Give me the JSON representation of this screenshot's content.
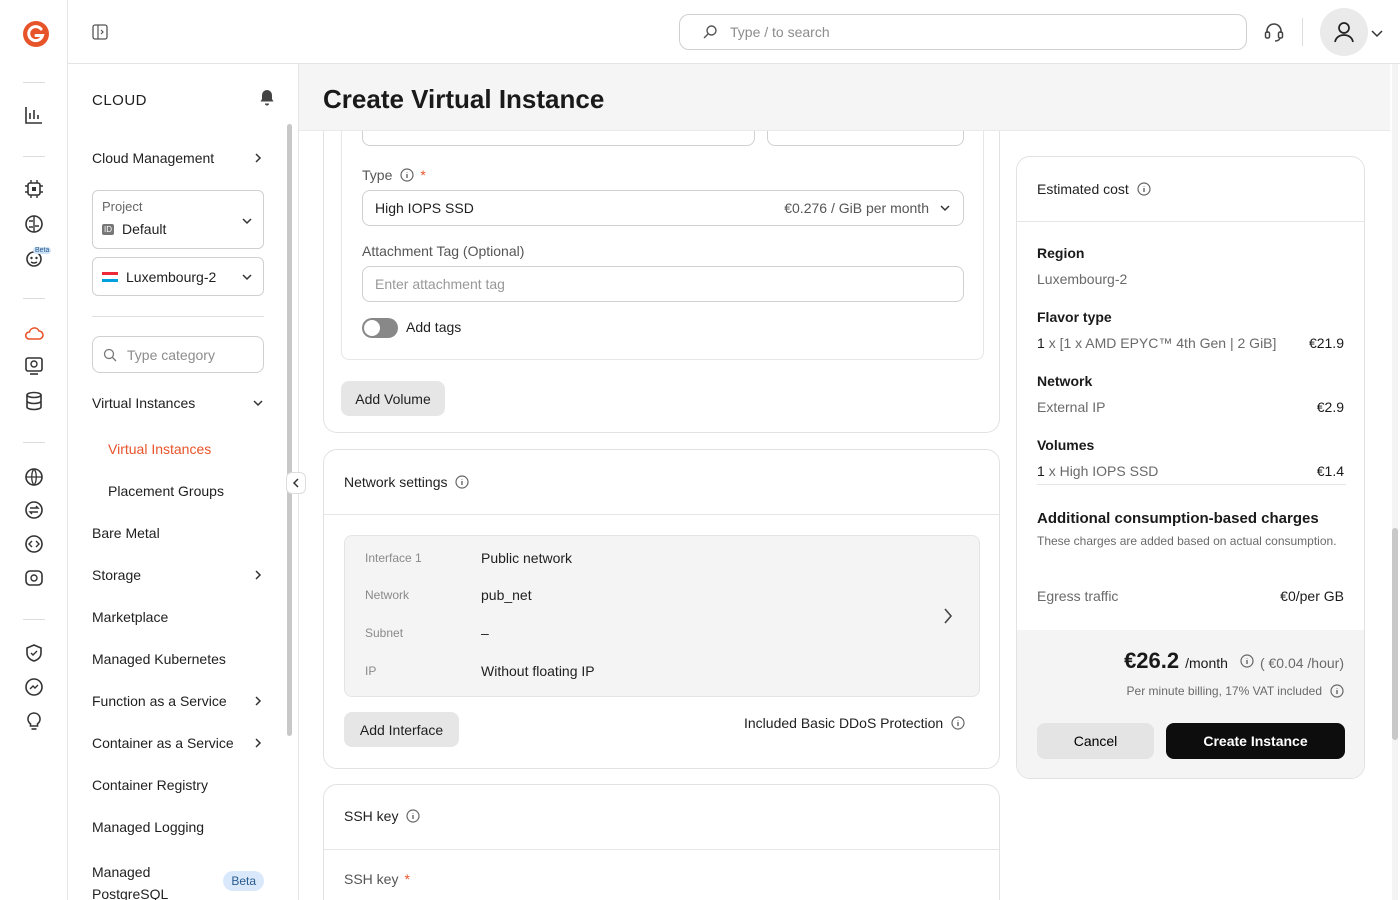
{
  "colors": {
    "accent": "#e8542a",
    "primary_button": "#0d0d0d",
    "beta_badge": "#d9e9fb"
  },
  "rail": {
    "icons": [
      "logo-icon",
      "analytics-icon",
      "chip-icon",
      "brain-icon",
      "robot-beta-icon",
      "cloud-icon",
      "monitor-icon",
      "database-icon",
      "globe-icon",
      "transfer-icon",
      "code-icon",
      "media-icon",
      "shield-icon",
      "handshake-icon",
      "bulb-icon"
    ],
    "beta_label": "Beta"
  },
  "topbar": {
    "search_placeholder": "Type / to search"
  },
  "sidebar": {
    "title": "CLOUD",
    "cloud_management": "Cloud Management",
    "project_label": "Project",
    "project_id_badge": "ID",
    "project_value": "Default",
    "region_value": "Luxembourg-2",
    "category_placeholder": "Type category",
    "items": [
      {
        "label": "Virtual Instances"
      },
      {
        "label": "Virtual Instances"
      },
      {
        "label": "Placement Groups"
      },
      {
        "label": "Bare Metal"
      },
      {
        "label": "Storage"
      },
      {
        "label": "Marketplace"
      },
      {
        "label": "Managed Kubernetes"
      },
      {
        "label": "Function as a Service"
      },
      {
        "label": "Container as a Service"
      },
      {
        "label": "Container Registry"
      },
      {
        "label": "Managed Logging"
      },
      {
        "label": "Managed PostgreSQL",
        "badge": "Beta"
      }
    ]
  },
  "main": {
    "title": "Create Virtual Instance",
    "volume": {
      "type_label": "Type",
      "type_value": "High IOPS SSD",
      "type_price": "€0.276 / GiB per month",
      "attachment_label": "Attachment Tag (Optional)",
      "attachment_placeholder": "Enter attachment tag",
      "add_tags_label": "Add tags",
      "add_volume_button": "Add Volume"
    },
    "network": {
      "title": "Network settings",
      "interface_label": "Interface 1",
      "interface_value": "Public network",
      "network_label": "Network",
      "network_value": "pub_net",
      "subnet_label": "Subnet",
      "subnet_value": "–",
      "ip_label": "IP",
      "ip_value": "Without floating IP",
      "add_interface_button": "Add Interface",
      "ddos_text": "Included Basic DDoS Protection"
    },
    "ssh": {
      "title": "SSH key",
      "field_label": "SSH key"
    }
  },
  "cost": {
    "title": "Estimated cost",
    "region_label": "Region",
    "region_value": "Luxembourg-2",
    "flavor_label": "Flavor type",
    "flavor_qty": "1",
    "flavor_desc": "x [1 x AMD EPYC™ 4th Gen | 2 GiB]",
    "flavor_price": "€21.9",
    "network_label": "Network",
    "network_item": "External IP",
    "network_price": "€2.9",
    "volumes_label": "Volumes",
    "volumes_qty": "1",
    "volumes_item": "x High IOPS SSD",
    "volumes_price": "€1.4",
    "additional_label": "Additional consumption-based charges",
    "additional_note": "These charges are added based on actual consumption.",
    "egress_label": "Egress traffic",
    "egress_price": "€0/per GB",
    "total": "€26.2",
    "total_unit": "/month",
    "hourly": "( €0.04 /hour)",
    "billing_note": "Per minute billing, 17% VAT included",
    "cancel_button": "Cancel",
    "create_button": "Create Instance"
  }
}
